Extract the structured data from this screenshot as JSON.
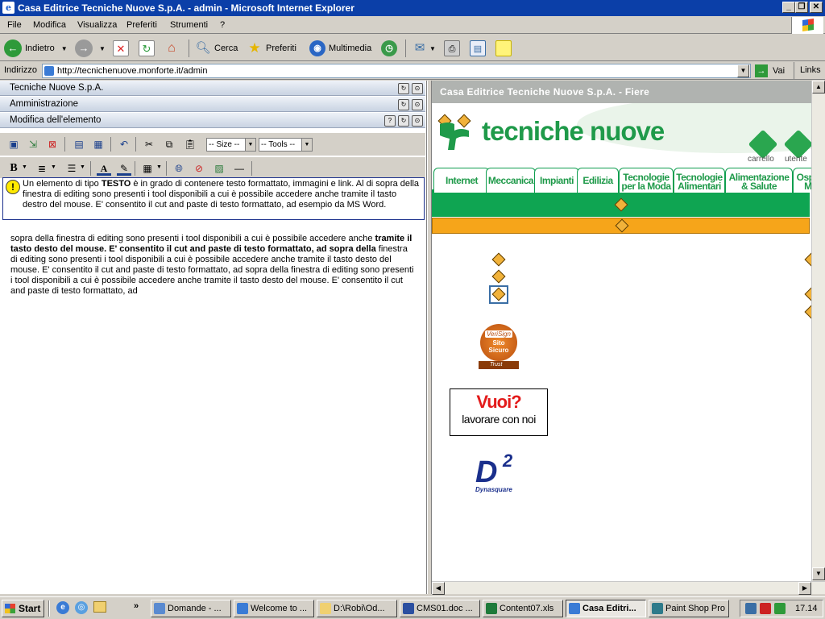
{
  "window": {
    "title": "Casa Editrice Tecniche Nuove S.p.A. - admin - Microsoft Internet Explorer",
    "minimize": "_",
    "maximize": "❐",
    "close": "✕"
  },
  "menu": {
    "items": [
      "File",
      "Modifica",
      "Visualizza",
      "Preferiti",
      "Strumenti",
      "?"
    ]
  },
  "toolbar": {
    "back_label": "Indietro",
    "search_label": "Cerca",
    "favorites_label": "Preferiti",
    "media_label": "Multimedia"
  },
  "address": {
    "label": "Indirizzo",
    "url": "http://tecnichenuove.monforte.it/admin",
    "go_label": "Vai",
    "links_label": "Links"
  },
  "left_panel": {
    "header1": "Tecniche Nuove S.p.A.",
    "header2": "Amministrazione",
    "header3": "Modifica dell'elemento",
    "size_select": "-- Size --",
    "tools_select": "-- Tools --",
    "bold_label": "B",
    "info_part1": "Un elemento di tipo ",
    "info_bold": "TESTO",
    "info_part2": " è in grado di contenere testo formattato, immagini e link. Al di sopra della finestra di editing sono presenti i tool disponibili a cui è possibile accedere anche tramite il tasto destro del mouse. E' consentito il cut and paste di testo formattato, ad esempio da MS Word.",
    "editor_part1": "sopra della finestra di editing sono presenti i tool disponibili a cui è possibile accedere anche ",
    "editor_bold": "tramite il tasto desto del mouse. E' consentito il cut and paste di testo formattato, ad sopra della",
    "editor_part2": " finestra di editing sono presenti i tool disponibili a cui è possibile accedere anche tramite il tasto desto del mouse. E' consentito il cut and paste di testo formattato, ad sopra della finestra di editing sono presenti i tool disponibili a cui è possibile accedere anche tramite il tasto desto del mouse. E' consentito il cut and paste di testo formattato, ad"
  },
  "right_panel": {
    "title": "Casa Editrice Tecniche Nuove S.p.A. - Fiere",
    "logo_text": "tecniche nuove",
    "cart_label": "carrello",
    "user_label": "utente",
    "nav_tabs": [
      "Internet",
      "Meccanica",
      "Impianti",
      "Edilizia",
      "Tecnologie per la Moda",
      "Tecnologie Alimentari",
      "Alimentazione & Salute",
      "Ospitalità & Meeting"
    ],
    "seal_line1": "VeriSign",
    "seal_line2": "Sito Sicuro",
    "seal_line3": "Trust",
    "vuoi_line1": "Vuoi?",
    "vuoi_line2": "lavorare con noi",
    "d2_logo": "D",
    "d2_sup": "2",
    "d2_name": "Dynasquare"
  },
  "taskbar": {
    "start_label": "Start",
    "tasks": [
      "Domande - ...",
      "Welcome to ...",
      "D:\\Robi\\Od...",
      "CMS01.doc ...",
      "Content07.xls",
      "Casa Editri...",
      "Paint Shop Pro"
    ],
    "clock": "17.14"
  },
  "colors": {
    "title_bar": "#0b3fa8",
    "brand_green": "#1f9a4a",
    "brand_orange": "#f6a51a"
  }
}
